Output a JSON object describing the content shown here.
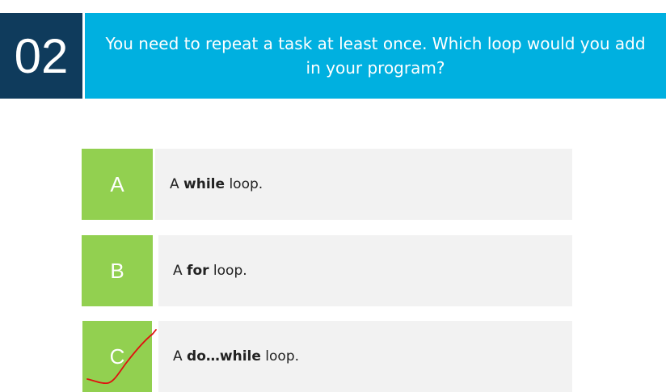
{
  "question": {
    "number": "02",
    "text": "You need to repeat a task at least once. Which loop would you add in your program?"
  },
  "options": [
    {
      "letter": "A",
      "prefix": "A ",
      "keyword": "while",
      "suffix": " loop."
    },
    {
      "letter": "B",
      "prefix": "A ",
      "keyword": "for",
      "suffix": " loop."
    },
    {
      "letter": "C",
      "prefix": "A ",
      "keyword": "do…while",
      "suffix": " loop."
    }
  ],
  "colors": {
    "number_bg": "#0f3b5c",
    "banner_bg": "#00b0e0",
    "letter_bg": "#92d050",
    "option_bg": "#f2f2f2",
    "check_mark": "#e01010"
  },
  "annotations": {
    "checkmark_on_option": "C"
  }
}
